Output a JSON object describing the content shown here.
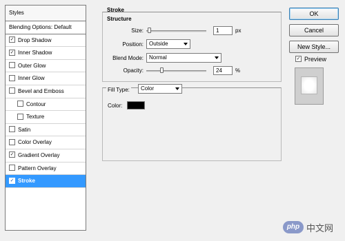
{
  "styles_panel": {
    "header": "Styles",
    "items": [
      {
        "label": "Blending Options: Default",
        "checkbox": false,
        "checked": false,
        "indent": false,
        "selected": false,
        "header": true
      },
      {
        "label": "Drop Shadow",
        "checkbox": true,
        "checked": true,
        "indent": false,
        "selected": false
      },
      {
        "label": "Inner Shadow",
        "checkbox": true,
        "checked": true,
        "indent": false,
        "selected": false
      },
      {
        "label": "Outer Glow",
        "checkbox": true,
        "checked": false,
        "indent": false,
        "selected": false
      },
      {
        "label": "Inner Glow",
        "checkbox": true,
        "checked": false,
        "indent": false,
        "selected": false
      },
      {
        "label": "Bevel and Emboss",
        "checkbox": true,
        "checked": false,
        "indent": false,
        "selected": false
      },
      {
        "label": "Contour",
        "checkbox": true,
        "checked": false,
        "indent": true,
        "selected": false
      },
      {
        "label": "Texture",
        "checkbox": true,
        "checked": false,
        "indent": true,
        "selected": false
      },
      {
        "label": "Satin",
        "checkbox": true,
        "checked": false,
        "indent": false,
        "selected": false
      },
      {
        "label": "Color Overlay",
        "checkbox": true,
        "checked": false,
        "indent": false,
        "selected": false
      },
      {
        "label": "Gradient Overlay",
        "checkbox": true,
        "checked": true,
        "indent": false,
        "selected": false
      },
      {
        "label": "Pattern Overlay",
        "checkbox": true,
        "checked": false,
        "indent": false,
        "selected": false
      },
      {
        "label": "Stroke",
        "checkbox": true,
        "checked": true,
        "indent": false,
        "selected": true
      }
    ]
  },
  "stroke": {
    "title": "Stroke",
    "structure_title": "Structure",
    "size": {
      "label": "Size:",
      "value": "1",
      "unit": "px",
      "slider_fraction": 0.02
    },
    "position": {
      "label": "Position:",
      "value": "Outside"
    },
    "blend_mode": {
      "label": "Blend Mode:",
      "value": "Normal"
    },
    "opacity": {
      "label": "Opacity:",
      "value": "24",
      "unit": "%",
      "slider_fraction": 0.24
    },
    "fill_type": {
      "label": "Fill Type:",
      "value": "Color"
    },
    "color": {
      "label": "Color:",
      "value": "#000000"
    }
  },
  "buttons": {
    "ok": "OK",
    "cancel": "Cancel",
    "new_style": "New Style..."
  },
  "preview": {
    "label": "Preview",
    "checked": true
  },
  "watermark": {
    "logo": "php",
    "text": "中文网"
  },
  "colors": {
    "selection": "#3399ff",
    "background": "#f0f0f0"
  }
}
